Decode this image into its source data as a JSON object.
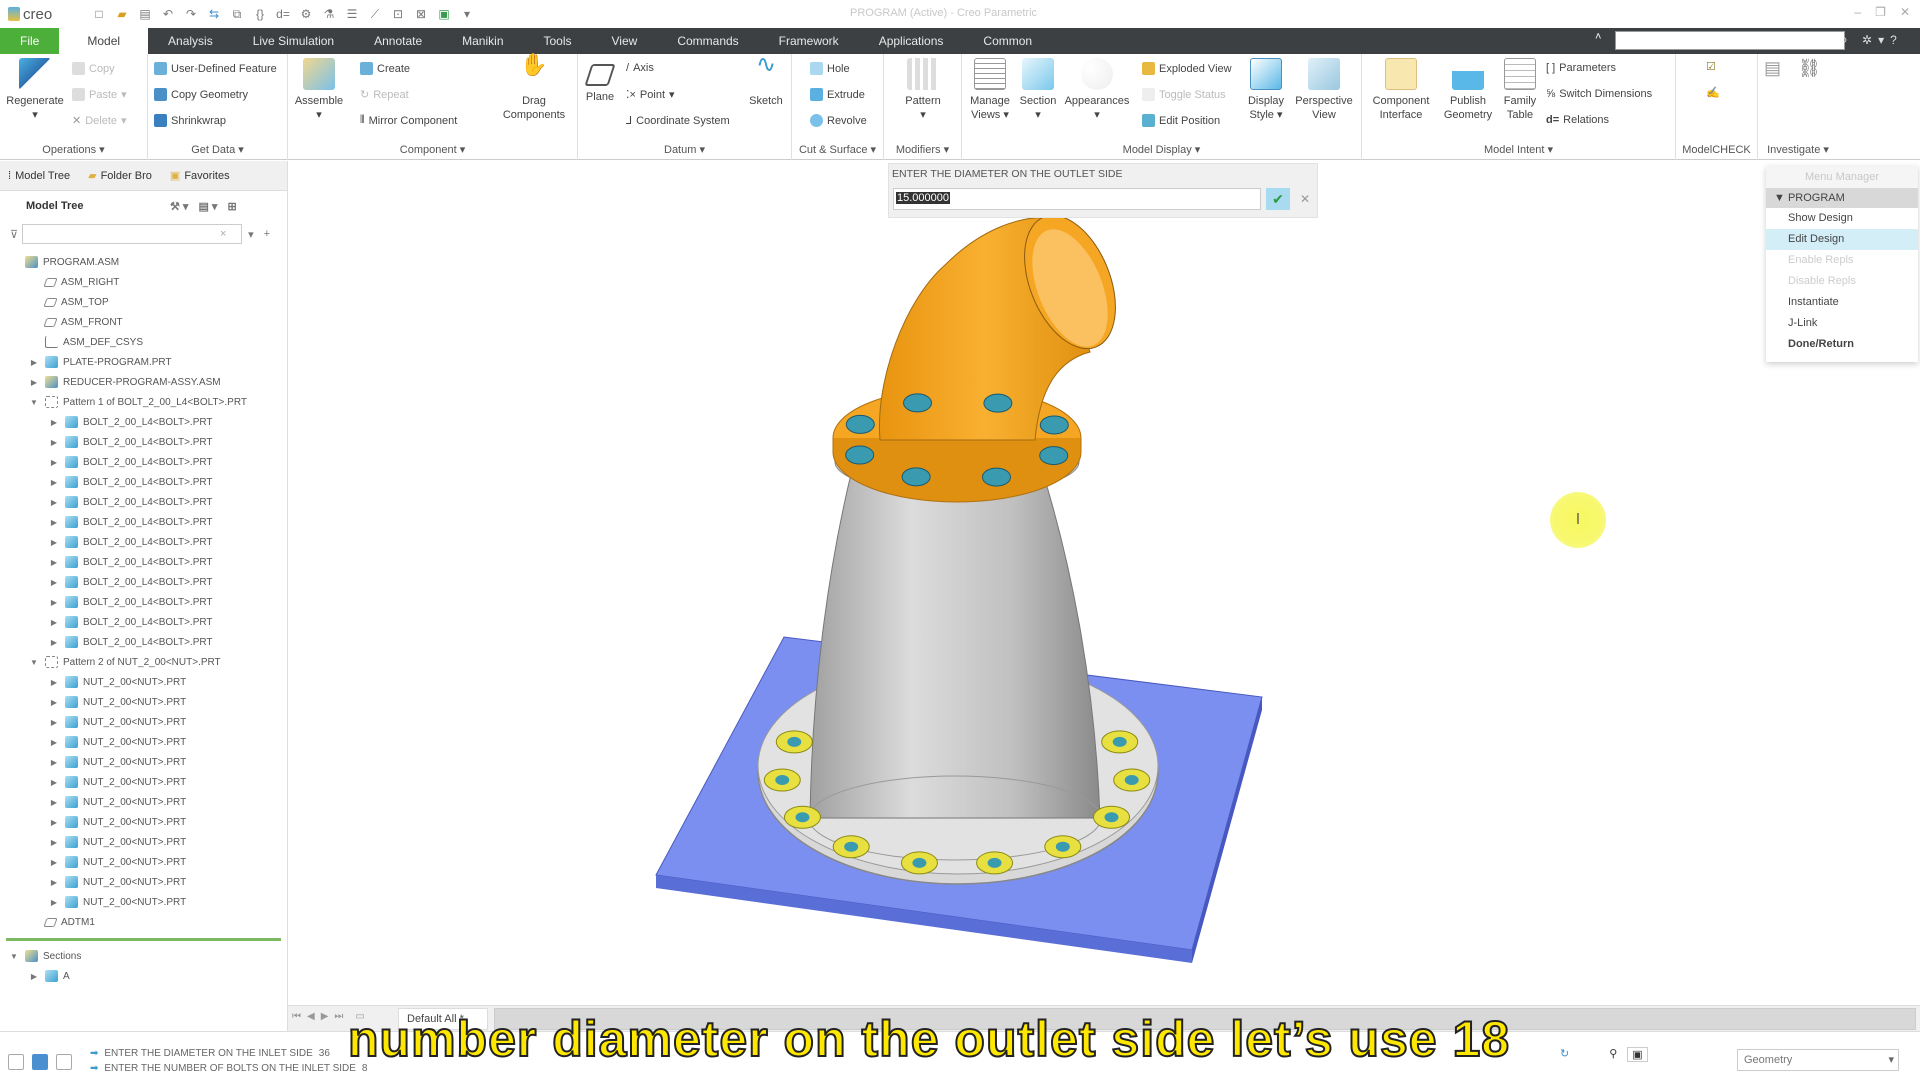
{
  "app": {
    "logo": "creo",
    "window_title": "PROGRAM (Active) - Creo Parametric"
  },
  "quick_access": [
    "new-icon",
    "open-icon",
    "save-icon",
    "undo-icon",
    "redo-icon",
    "regenerate-icon",
    "windows-icon",
    "parameters-icon",
    "relations-icon",
    "assembly-icon",
    "analysis-icon",
    "layers-icon",
    "measure-icon",
    "view-icon",
    "close-icon",
    "display-icon",
    "customize-icon"
  ],
  "menubar": {
    "tabs": [
      "File",
      "Model",
      "Analysis",
      "Live Simulation",
      "Annotate",
      "Manikin",
      "Tools",
      "View",
      "Commands",
      "Framework",
      "Applications",
      "Common"
    ],
    "active": "Model",
    "search_placeholder": ""
  },
  "ribbon": {
    "operations": {
      "label": "Operations",
      "regenerate": "Regenerate",
      "copy": "Copy",
      "paste": "Paste",
      "delete": "Delete"
    },
    "get_data": {
      "label": "Get Data",
      "udf": "User-Defined Feature",
      "copy_geometry": "Copy Geometry",
      "shrinkwrap": "Shrinkwrap"
    },
    "component": {
      "label": "Component",
      "assemble": "Assemble",
      "create": "Create",
      "repeat": "Repeat",
      "mirror": "Mirror Component",
      "drag": "Drag Components"
    },
    "datum": {
      "label": "Datum",
      "plane": "Plane",
      "axis": "Axis",
      "point": "Point",
      "csys": "Coordinate System",
      "sketch": "Sketch"
    },
    "cut_surface": {
      "label": "Cut & Surface",
      "hole": "Hole",
      "extrude": "Extrude",
      "revolve": "Revolve"
    },
    "modifiers": {
      "label": "Modifiers",
      "pattern": "Pattern"
    },
    "model_display": {
      "label": "Model Display",
      "manage_views": "Manage Views",
      "section": "Section",
      "appearances": "Appearances",
      "exploded": "Exploded View",
      "toggle": "Toggle Status",
      "edit_position": "Edit Position",
      "display_style": "Display Style",
      "perspective": "Perspective View"
    },
    "model_intent": {
      "label": "Model Intent",
      "component_interface": "Component Interface",
      "publish_geometry": "Publish Geometry",
      "family_table": "Family Table",
      "parameters": "Parameters",
      "switch_dimensions": "Switch Dimensions",
      "relations": "Relations"
    },
    "modelcheck": {
      "label": "ModelCHECK"
    },
    "investigate": {
      "label": "Investigate"
    }
  },
  "panel": {
    "tabs": [
      "Model Tree",
      "Folder Bro",
      "Favorites"
    ],
    "header": "Model Tree",
    "filter_value": "",
    "tree": [
      {
        "label": "PROGRAM.ASM",
        "type": "asm",
        "level": 0,
        "toggle": ""
      },
      {
        "label": "ASM_RIGHT",
        "type": "plane",
        "level": 1,
        "toggle": ""
      },
      {
        "label": "ASM_TOP",
        "type": "plane",
        "level": 1,
        "toggle": ""
      },
      {
        "label": "ASM_FRONT",
        "type": "plane",
        "level": 1,
        "toggle": ""
      },
      {
        "label": "ASM_DEF_CSYS",
        "type": "csys",
        "level": 1,
        "toggle": ""
      },
      {
        "label": "PLATE-PROGRAM.PRT",
        "type": "part",
        "level": 1,
        "toggle": "▶"
      },
      {
        "label": "REDUCER-PROGRAM-ASSY.ASM",
        "type": "asm",
        "level": 1,
        "toggle": "▶"
      },
      {
        "label": "Pattern 1 of BOLT_2_00_L4<BOLT>.PRT",
        "type": "pat",
        "level": 1,
        "toggle": "▼"
      },
      {
        "label": "BOLT_2_00_L4<BOLT>.PRT",
        "type": "part",
        "level": 2,
        "toggle": "▶"
      },
      {
        "label": "BOLT_2_00_L4<BOLT>.PRT",
        "type": "part",
        "level": 2,
        "toggle": "▶"
      },
      {
        "label": "BOLT_2_00_L4<BOLT>.PRT",
        "type": "part",
        "level": 2,
        "toggle": "▶"
      },
      {
        "label": "BOLT_2_00_L4<BOLT>.PRT",
        "type": "part",
        "level": 2,
        "toggle": "▶"
      },
      {
        "label": "BOLT_2_00_L4<BOLT>.PRT",
        "type": "part",
        "level": 2,
        "toggle": "▶"
      },
      {
        "label": "BOLT_2_00_L4<BOLT>.PRT",
        "type": "part",
        "level": 2,
        "toggle": "▶"
      },
      {
        "label": "BOLT_2_00_L4<BOLT>.PRT",
        "type": "part",
        "level": 2,
        "toggle": "▶"
      },
      {
        "label": "BOLT_2_00_L4<BOLT>.PRT",
        "type": "part",
        "level": 2,
        "toggle": "▶"
      },
      {
        "label": "BOLT_2_00_L4<BOLT>.PRT",
        "type": "part",
        "level": 2,
        "toggle": "▶"
      },
      {
        "label": "BOLT_2_00_L4<BOLT>.PRT",
        "type": "part",
        "level": 2,
        "toggle": "▶"
      },
      {
        "label": "BOLT_2_00_L4<BOLT>.PRT",
        "type": "part",
        "level": 2,
        "toggle": "▶"
      },
      {
        "label": "BOLT_2_00_L4<BOLT>.PRT",
        "type": "part",
        "level": 2,
        "toggle": "▶"
      },
      {
        "label": "Pattern 2 of NUT_2_00<NUT>.PRT",
        "type": "pat",
        "level": 1,
        "toggle": "▼"
      },
      {
        "label": "NUT_2_00<NUT>.PRT",
        "type": "part",
        "level": 2,
        "toggle": "▶"
      },
      {
        "label": "NUT_2_00<NUT>.PRT",
        "type": "part",
        "level": 2,
        "toggle": "▶"
      },
      {
        "label": "NUT_2_00<NUT>.PRT",
        "type": "part",
        "level": 2,
        "toggle": "▶"
      },
      {
        "label": "NUT_2_00<NUT>.PRT",
        "type": "part",
        "level": 2,
        "toggle": "▶"
      },
      {
        "label": "NUT_2_00<NUT>.PRT",
        "type": "part",
        "level": 2,
        "toggle": "▶"
      },
      {
        "label": "NUT_2_00<NUT>.PRT",
        "type": "part",
        "level": 2,
        "toggle": "▶"
      },
      {
        "label": "NUT_2_00<NUT>.PRT",
        "type": "part",
        "level": 2,
        "toggle": "▶"
      },
      {
        "label": "NUT_2_00<NUT>.PRT",
        "type": "part",
        "level": 2,
        "toggle": "▶"
      },
      {
        "label": "NUT_2_00<NUT>.PRT",
        "type": "part",
        "level": 2,
        "toggle": "▶"
      },
      {
        "label": "NUT_2_00<NUT>.PRT",
        "type": "part",
        "level": 2,
        "toggle": "▶"
      },
      {
        "label": "NUT_2_00<NUT>.PRT",
        "type": "part",
        "level": 2,
        "toggle": "▶"
      },
      {
        "label": "NUT_2_00<NUT>.PRT",
        "type": "part",
        "level": 2,
        "toggle": "▶"
      },
      {
        "label": "ADTM1",
        "type": "plane",
        "level": 1,
        "toggle": ""
      }
    ],
    "sections": [
      {
        "label": "Sections",
        "type": "asm",
        "level": 0,
        "toggle": "▼"
      },
      {
        "label": "A",
        "type": "part",
        "level": 1,
        "toggle": "▶"
      }
    ]
  },
  "prompt": {
    "label": "ENTER THE DIAMETER ON THE OUTLET SIDE",
    "value": "15.000000"
  },
  "menu_manager": {
    "title": "Menu Manager",
    "header": "PROGRAM",
    "items": [
      {
        "label": "Show Design",
        "state": "normal"
      },
      {
        "label": "Edit Design",
        "state": "highlight"
      },
      {
        "label": "Enable Repls",
        "state": "disabled"
      },
      {
        "label": "Disable Repls",
        "state": "disabled"
      },
      {
        "label": "Instantiate",
        "state": "normal"
      },
      {
        "label": "J-Link",
        "state": "normal"
      },
      {
        "label": "Done/Return",
        "state": "bold"
      }
    ]
  },
  "bottom": {
    "view_tab": "Default All *"
  },
  "status": {
    "messages": [
      {
        "text": "ENTER THE DIAMETER ON THE INLET SIDE",
        "value": "36"
      },
      {
        "text": "ENTER THE NUMBER OF BOLTS ON THE INLET SIDE",
        "value": "8"
      }
    ],
    "filter": "Geometry"
  },
  "subtitle": "number diameter on the outlet side let’s use 18",
  "colors": {
    "file_tab": "#4caf3a",
    "menubar": "#3c4043",
    "elbow": "#f5a623",
    "plate": "#7b8ff0",
    "reducer": "#c8c8c8",
    "nut": "#e8e040",
    "bolt": "#3a9bb0"
  }
}
